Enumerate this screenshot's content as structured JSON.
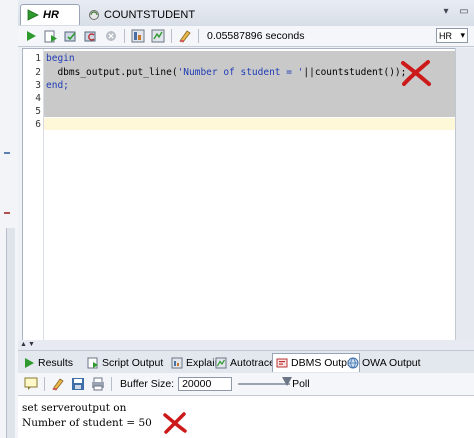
{
  "tabs": [
    {
      "label": "HR",
      "icon": "sql-worksheet-icon",
      "active": true
    },
    {
      "label": "COUNTSTUDENT",
      "icon": "procedure-icon",
      "active": false
    }
  ],
  "toolbar": {
    "elapsed": "0.05587896 seconds",
    "connection": "HR",
    "icons": [
      "run-statement-icon",
      "run-script-icon",
      "commit-icon",
      "rollback-icon",
      "cancel-icon",
      "sql-tuning-icon",
      "autotrace-icon",
      "clear-icon"
    ]
  },
  "editor": {
    "line_numbers": [
      "1",
      "2",
      "3",
      "4",
      "5",
      "6"
    ],
    "lines": {
      "l1": "begin",
      "l2_prefix": "  dbms_output.put_line(",
      "l2_string": "'Number of student = '",
      "l2_suffix": "||countstudent());",
      "l3": "end;"
    },
    "mark_color": "#cc1a1a"
  },
  "output_tabs": [
    {
      "label": "Results",
      "icon": "results-icon"
    },
    {
      "label": "Script Output",
      "icon": "script-output-icon"
    },
    {
      "label": "Explain",
      "icon": "explain-icon"
    },
    {
      "label": "Autotrace",
      "icon": "autotrace-icon"
    },
    {
      "label": "DBMS Output",
      "icon": "dbms-output-icon",
      "active": true
    },
    {
      "label": "OWA Output",
      "icon": "owa-output-icon"
    }
  ],
  "output_toolbar": {
    "buffer_label": "Buffer Size:",
    "buffer_value": "20000",
    "poll_label": "Poll"
  },
  "output": {
    "lines": [
      "set serveroutput on",
      "Number of student = 50"
    ]
  }
}
